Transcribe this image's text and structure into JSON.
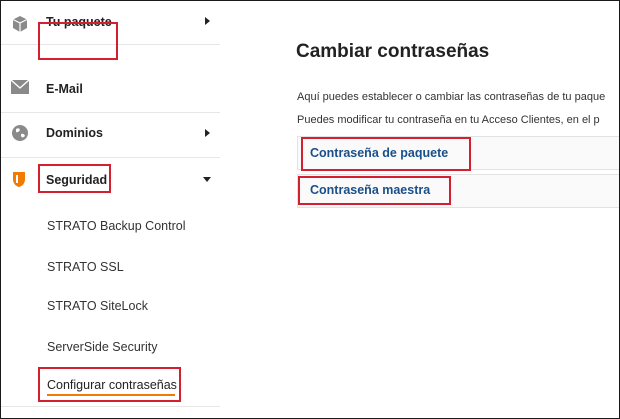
{
  "sidebar": {
    "items": [
      {
        "label": "Tu paquete",
        "icon": "package-icon"
      },
      {
        "label": "E-Mail",
        "icon": "mail-icon"
      },
      {
        "label": "Dominios",
        "icon": "globe-icon"
      },
      {
        "label": "Seguridad",
        "icon": "shield-icon"
      }
    ],
    "subitems": [
      {
        "label": "STRATO Backup Control"
      },
      {
        "label": "STRATO SSL"
      },
      {
        "label": "STRATO SiteLock"
      },
      {
        "label": "ServerSide Security"
      },
      {
        "label": "Configurar contraseñas"
      }
    ]
  },
  "main": {
    "title": "Cambiar contraseñas",
    "paragraphs": [
      "Aquí puedes establecer o cambiar las contraseñas de tu paque",
      "Puedes modificar tu contraseña en tu Acceso Clientes, en el p"
    ],
    "links": [
      {
        "label": "Contraseña de paquete"
      },
      {
        "label": "Contraseña maestra"
      }
    ]
  },
  "colors": {
    "accent": "#f07b00",
    "link": "#1a4f8a",
    "highlight": "#d22030",
    "shield": "#f07b00"
  }
}
